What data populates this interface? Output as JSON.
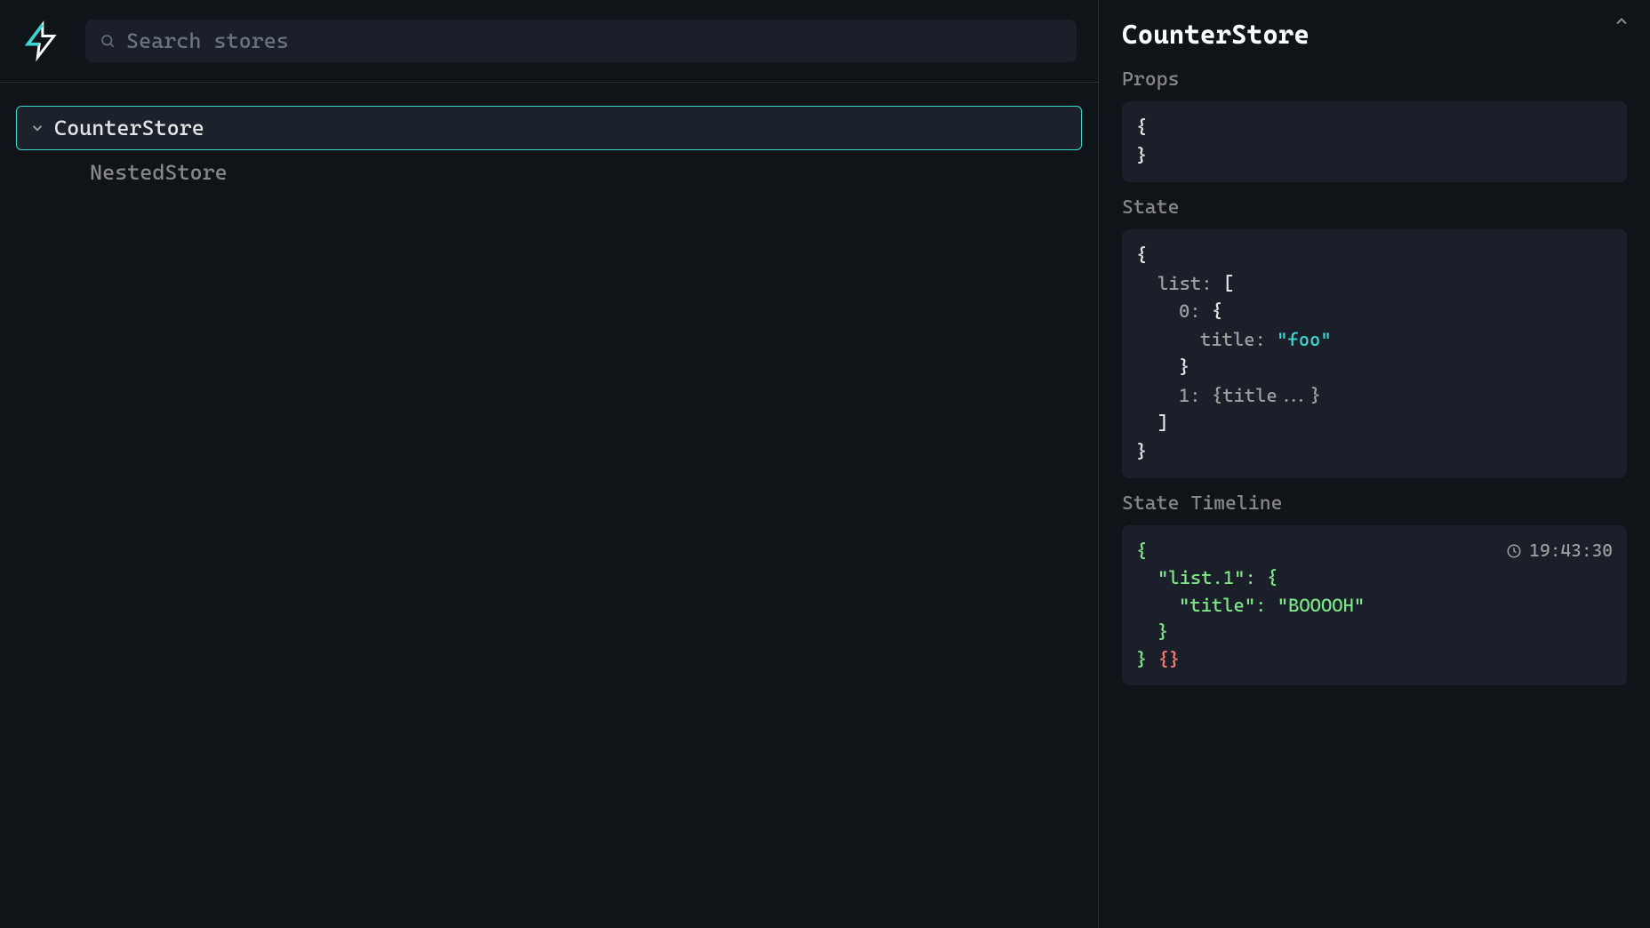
{
  "search": {
    "placeholder": "Search stores"
  },
  "tree": {
    "items": [
      {
        "label": "CounterStore",
        "selected": true,
        "expanded": true
      },
      {
        "label": "NestedStore",
        "selected": false,
        "nested": true
      }
    ]
  },
  "detail": {
    "title": "CounterStore",
    "sections": {
      "props_label": "Props",
      "state_label": "State",
      "timeline_label": "State Timeline"
    },
    "props_code": {
      "open": "{",
      "close": "}"
    },
    "state_code": {
      "open": "{",
      "list_key": "list:",
      "list_open": "[",
      "idx0": "0:",
      "obj_open": "{",
      "title_key": "title:",
      "title_val": "\"foo\"",
      "obj_close": "}",
      "idx1": "1:",
      "collapsed": "{title...}",
      "list_close": "]",
      "close": "}"
    },
    "timeline": {
      "timestamp": "19:43:30",
      "diff_open": "{",
      "diff_key": "\"list.1\": {",
      "diff_title": "\"title\": \"BOOOOH\"",
      "diff_inner_close": "}",
      "diff_close": "}",
      "removed": "{}"
    }
  }
}
